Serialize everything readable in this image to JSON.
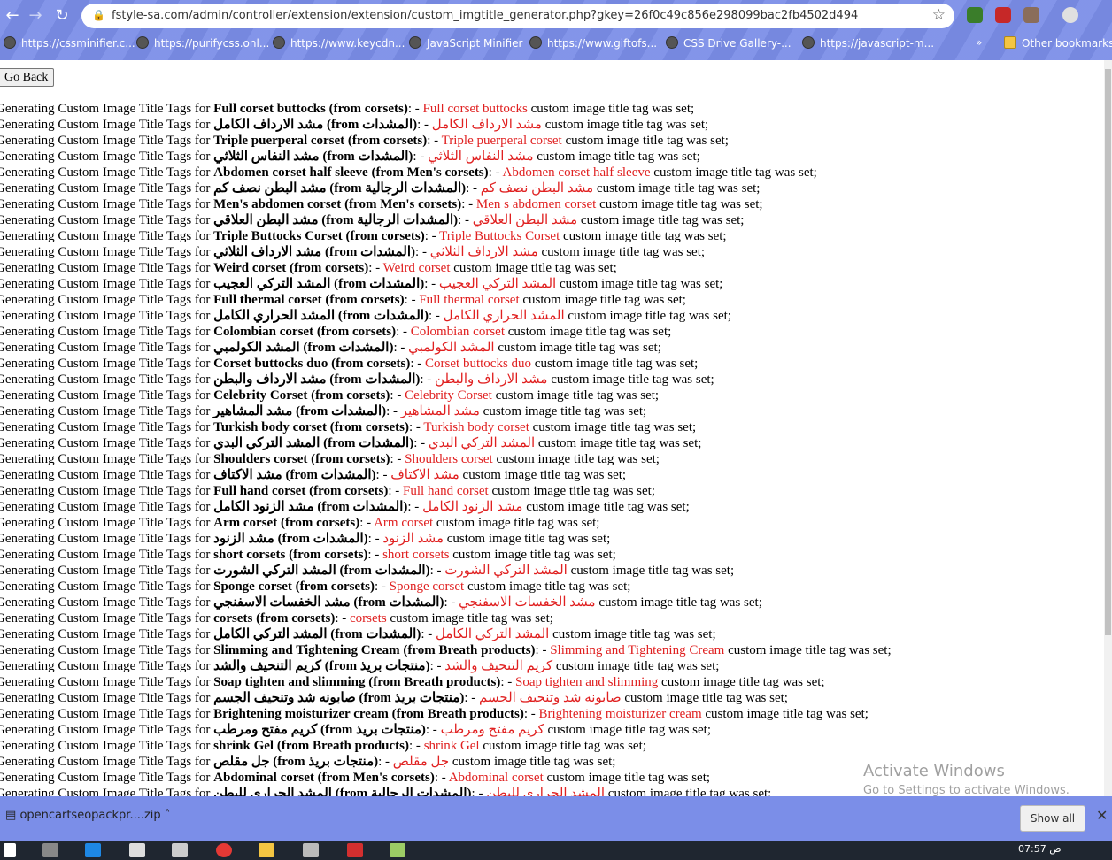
{
  "browser": {
    "url": "fstyle-sa.com/admin/controller/extension/extension/custom_imgtitle_generator.php?gkey=26f0c49c856e298099bac2fb4502d494",
    "bookmarks": [
      "https://cssminifier.c...",
      "https://purifycss.onl...",
      "https://www.keycdn...",
      "JavaScript Minifier",
      "https://www.giftofs...",
      "CSS Drive Gallery-...",
      "https://javascript-m...",
      "Other bookmarks"
    ]
  },
  "page": {
    "go_back_label": "Go Back",
    "prefix": "Generating Custom Image Title Tags for",
    "suffix": "custom image title tag was set;",
    "lines": [
      {
        "name": "Full corset buttocks",
        "category": "corsets",
        "tag": "Full corset buttocks",
        "rtl": false
      },
      {
        "name": "مشد الارداف الكامل",
        "category": "المشدات",
        "tag": "مشد الارداف الكامل",
        "rtl": true
      },
      {
        "name": "Triple puerperal corset",
        "category": "corsets",
        "tag": "Triple puerperal corset",
        "rtl": false
      },
      {
        "name": "مشد النفاس الثلاثي",
        "category": "المشدات",
        "tag": "مشد النفاس الثلاثي",
        "rtl": true
      },
      {
        "name": "Abdomen corset half sleeve",
        "category": "Men's corsets",
        "tag": "Abdomen corset half sleeve",
        "rtl": false
      },
      {
        "name": "مشد البطن نصف كم",
        "category": "المشدات الرجالية",
        "tag": "مشد البطن نصف كم",
        "rtl": true
      },
      {
        "name": "Men's abdomen corset",
        "category": "Men's corsets",
        "tag": "Men s abdomen corset",
        "rtl": false
      },
      {
        "name": "مشد البطن العلاقي",
        "category": "المشدات الرجالية",
        "tag": "مشد البطن العلاقي",
        "rtl": true
      },
      {
        "name": "Triple Buttocks Corset",
        "category": "corsets",
        "tag": "Triple Buttocks Corset",
        "rtl": false
      },
      {
        "name": "مشد الارداف الثلاثي",
        "category": "المشدات",
        "tag": "مشد الارداف الثلاثي",
        "rtl": true
      },
      {
        "name": "Weird corset",
        "category": "corsets",
        "tag": "Weird corset",
        "rtl": false
      },
      {
        "name": "المشد التركي العجيب",
        "category": "المشدات",
        "tag": "المشد التركي العجيب",
        "rtl": true
      },
      {
        "name": "Full thermal corset",
        "category": "corsets",
        "tag": "Full thermal corset",
        "rtl": false
      },
      {
        "name": "المشد الحراري الكامل",
        "category": "المشدات",
        "tag": "المشد الحراري الكامل",
        "rtl": true
      },
      {
        "name": "Colombian corset",
        "category": "corsets",
        "tag": "Colombian corset",
        "rtl": false
      },
      {
        "name": "المشد الكولمبي",
        "category": "المشدات",
        "tag": "المشد الكولمبي",
        "rtl": true
      },
      {
        "name": "Corset buttocks duo",
        "category": "corsets",
        "tag": "Corset buttocks duo",
        "rtl": false
      },
      {
        "name": "مشد الارداف والبطن",
        "category": "المشدات",
        "tag": "مشد الارداف والبطن",
        "rtl": true
      },
      {
        "name": "Celebrity Corset  ",
        "category": "corsets",
        "tag": "Celebrity Corset  ",
        "rtl": false
      },
      {
        "name": "مشد المشاهير",
        "category": "المشدات",
        "tag": "مشد المشاهير",
        "rtl": true
      },
      {
        "name": "Turkish body corset",
        "category": "corsets",
        "tag": "Turkish body corset",
        "rtl": false
      },
      {
        "name": "المشد التركي البدي",
        "category": "المشدات",
        "tag": "المشد التركي البدي",
        "rtl": true
      },
      {
        "name": "Shoulders corset",
        "category": "corsets",
        "tag": "Shoulders corset",
        "rtl": false
      },
      {
        "name": "مشد الاكتاف",
        "category": "المشدات",
        "tag": "مشد الاكتاف",
        "rtl": true
      },
      {
        "name": "Full hand corset",
        "category": "corsets",
        "tag": "Full hand corset",
        "rtl": false
      },
      {
        "name": "مشد الزنود الكامل",
        "category": "المشدات",
        "tag": "مشد الزنود الكامل",
        "rtl": true
      },
      {
        "name": "Arm corset",
        "category": "corsets",
        "tag": "Arm corset",
        "rtl": false
      },
      {
        "name": "مشد الزنود",
        "category": "المشدات",
        "tag": "مشد الزنود",
        "rtl": true
      },
      {
        "name": "short corsets",
        "category": "corsets",
        "tag": "short corsets",
        "rtl": false
      },
      {
        "name": "المشد التركي الشورت",
        "category": "المشدات",
        "tag": "المشد التركي الشورت",
        "rtl": true
      },
      {
        "name": "Sponge corset",
        "category": "corsets",
        "tag": "Sponge corset",
        "rtl": false
      },
      {
        "name": "مشد الخفسات الاسفنجي",
        "category": "المشدات",
        "tag": "مشد الخفسات الاسفنجي",
        "rtl": true
      },
      {
        "name": "corsets",
        "category": "corsets",
        "tag": "corsets",
        "rtl": false
      },
      {
        "name": "المشد التركي الكامل",
        "category": "المشدات",
        "tag": "المشد التركي الكامل",
        "rtl": true
      },
      {
        "name": "Slimming and Tightening Cream",
        "category": "Breath products",
        "tag": "Slimming and Tightening Cream",
        "rtl": false
      },
      {
        "name": "كريم التنحيف والشد",
        "category": "منتجات بريذ",
        "tag": "كريم التنحيف والشد",
        "rtl": true
      },
      {
        "name": "Soap tighten and slimming  ",
        "category": "Breath products",
        "tag": "Soap tighten and slimming  ",
        "rtl": false
      },
      {
        "name": "صابونه شد وتنحيف الجسم",
        "category": "منتجات بريذ",
        "tag": "صابونه شد وتنحيف الجسم",
        "rtl": true
      },
      {
        "name": "Brightening moisturizer cream",
        "category": "Breath products",
        "tag": "Brightening moisturizer cream",
        "rtl": false
      },
      {
        "name": "كريم مفتح ومرطب",
        "category": "منتجات بريذ",
        "tag": "كريم مفتح ومرطب",
        "rtl": true
      },
      {
        "name": "shrink Gel",
        "category": "Breath products",
        "tag": "shrink Gel",
        "rtl": false
      },
      {
        "name": "جل مقلص",
        "category": "منتجات بريذ",
        "tag": "جل مقلص",
        "rtl": true
      },
      {
        "name": "Abdominal corset",
        "category": "Men's corsets",
        "tag": "Abdominal corset",
        "rtl": false
      },
      {
        "name": "المشد الحراري للبطن",
        "category": "المشدات الرجالية",
        "tag": "المشد الحراري للبطن",
        "rtl": true
      }
    ]
  },
  "watermark": {
    "line1": "Activate Windows",
    "line2": "Go to Settings to activate Windows."
  },
  "downloads": {
    "file": "opencartseopackpr....zip",
    "show_all": "Show all"
  },
  "taskbar": {
    "time": "07:57 ص"
  },
  "colors": {
    "chrome": "#7b8ee8",
    "tag_red": "#e02020"
  }
}
